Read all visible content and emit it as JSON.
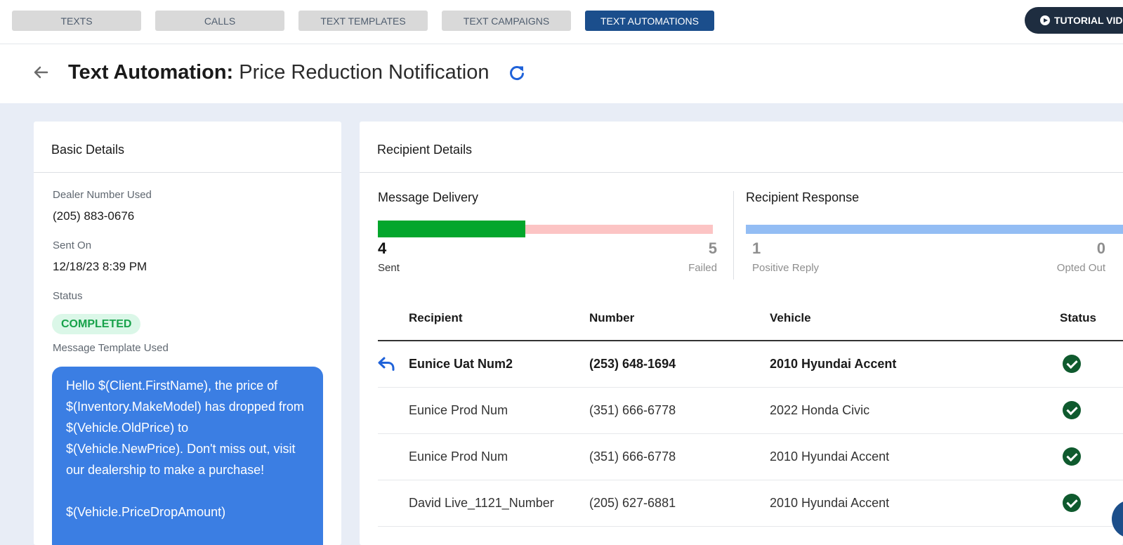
{
  "nav": {
    "tabs": [
      {
        "label": "TEXTS"
      },
      {
        "label": "CALLS"
      },
      {
        "label": "TEXT TEMPLATES"
      },
      {
        "label": "TEXT CAMPAIGNS"
      },
      {
        "label": "TEXT AUTOMATIONS",
        "active": true
      }
    ],
    "tutorial_label": "TUTORIAL VID"
  },
  "header": {
    "title_prefix": "Text Automation:",
    "title_name": "Price Reduction Notification"
  },
  "basic": {
    "title": "Basic Details",
    "dealer_label": "Dealer Number Used",
    "dealer_value": "(205) 883-0676",
    "sent_label": "Sent On",
    "sent_value": "12/18/23 8:39 PM",
    "status_label": "Status",
    "status_value": "COMPLETED",
    "template_label": "Message Template Used",
    "template_text": "Hello $(Client.FirstName), the price of $(Inventory.MakeModel) has dropped from $(Vehicle.OldPrice) to $(Vehicle.NewPrice). Don't miss out, visit our dealership to make a purchase!\n\n$(Vehicle.PriceDropAmount)"
  },
  "recipients": {
    "title": "Recipient Details",
    "delivery": {
      "title": "Message Delivery",
      "sent": "4",
      "sent_label": "Sent",
      "failed": "5",
      "failed_label": "Failed",
      "sent_fraction": 0.44
    },
    "response": {
      "title": "Recipient Response",
      "positive": "1",
      "positive_label": "Positive Reply",
      "opted_out": "0",
      "opted_out_label": "Opted Out"
    },
    "columns": {
      "recipient": "Recipient",
      "number": "Number",
      "vehicle": "Vehicle",
      "status": "Status"
    },
    "rows": [
      {
        "name": "Eunice Uat Num2",
        "number": "(253) 648-1694",
        "vehicle": "2010 Hyundai Accent"
      },
      {
        "name": "Eunice Prod Num",
        "number": "(351) 666-6778",
        "vehicle": "2022 Honda Civic"
      },
      {
        "name": "Eunice Prod Num",
        "number": "(351) 666-6778",
        "vehicle": "2010 Hyundai Accent"
      },
      {
        "name": "David Live_1121_Number",
        "number": "(205) 627-6881",
        "vehicle": "2010 Hyundai Accent"
      }
    ]
  },
  "colors": {
    "sent_bar": "#03a62c",
    "failed_bar": "#fcc4c4",
    "response_bar": "#93bdf4",
    "active_tab": "#1b4e8c"
  }
}
